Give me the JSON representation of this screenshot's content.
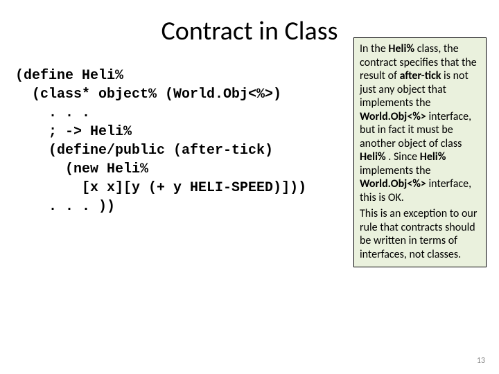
{
  "title": "Contract in Class",
  "code": "(define Heli%\n  (class* object% (World.Obj<%>)\n    . . .\n    ; -> Heli%\n    (define/public (after-tick)\n      (new Heli%\n        [x x][y (+ y HELI-SPEED)]))\n    . . . ))",
  "note": {
    "p1a": "In the ",
    "p1b": "Heli%",
    "p1c": " class, the contract specifies that the result of ",
    "p1d": "after-tick",
    "p1e": " is not just any object that implements the ",
    "p1f": "World.Obj<%>",
    "p1g": " interface, but in fact it must be another object of class ",
    "p1h": "Heli%",
    "p1i": " .  Since ",
    "p1j": "Heli%",
    "p1k": " implements the ",
    "p1l": "World.Obj<%>",
    "p1m": " interface, this is OK.",
    "p2": "This is an exception to our rule that contracts should be written  in terms of interfaces, not classes."
  },
  "pageNumber": "13"
}
